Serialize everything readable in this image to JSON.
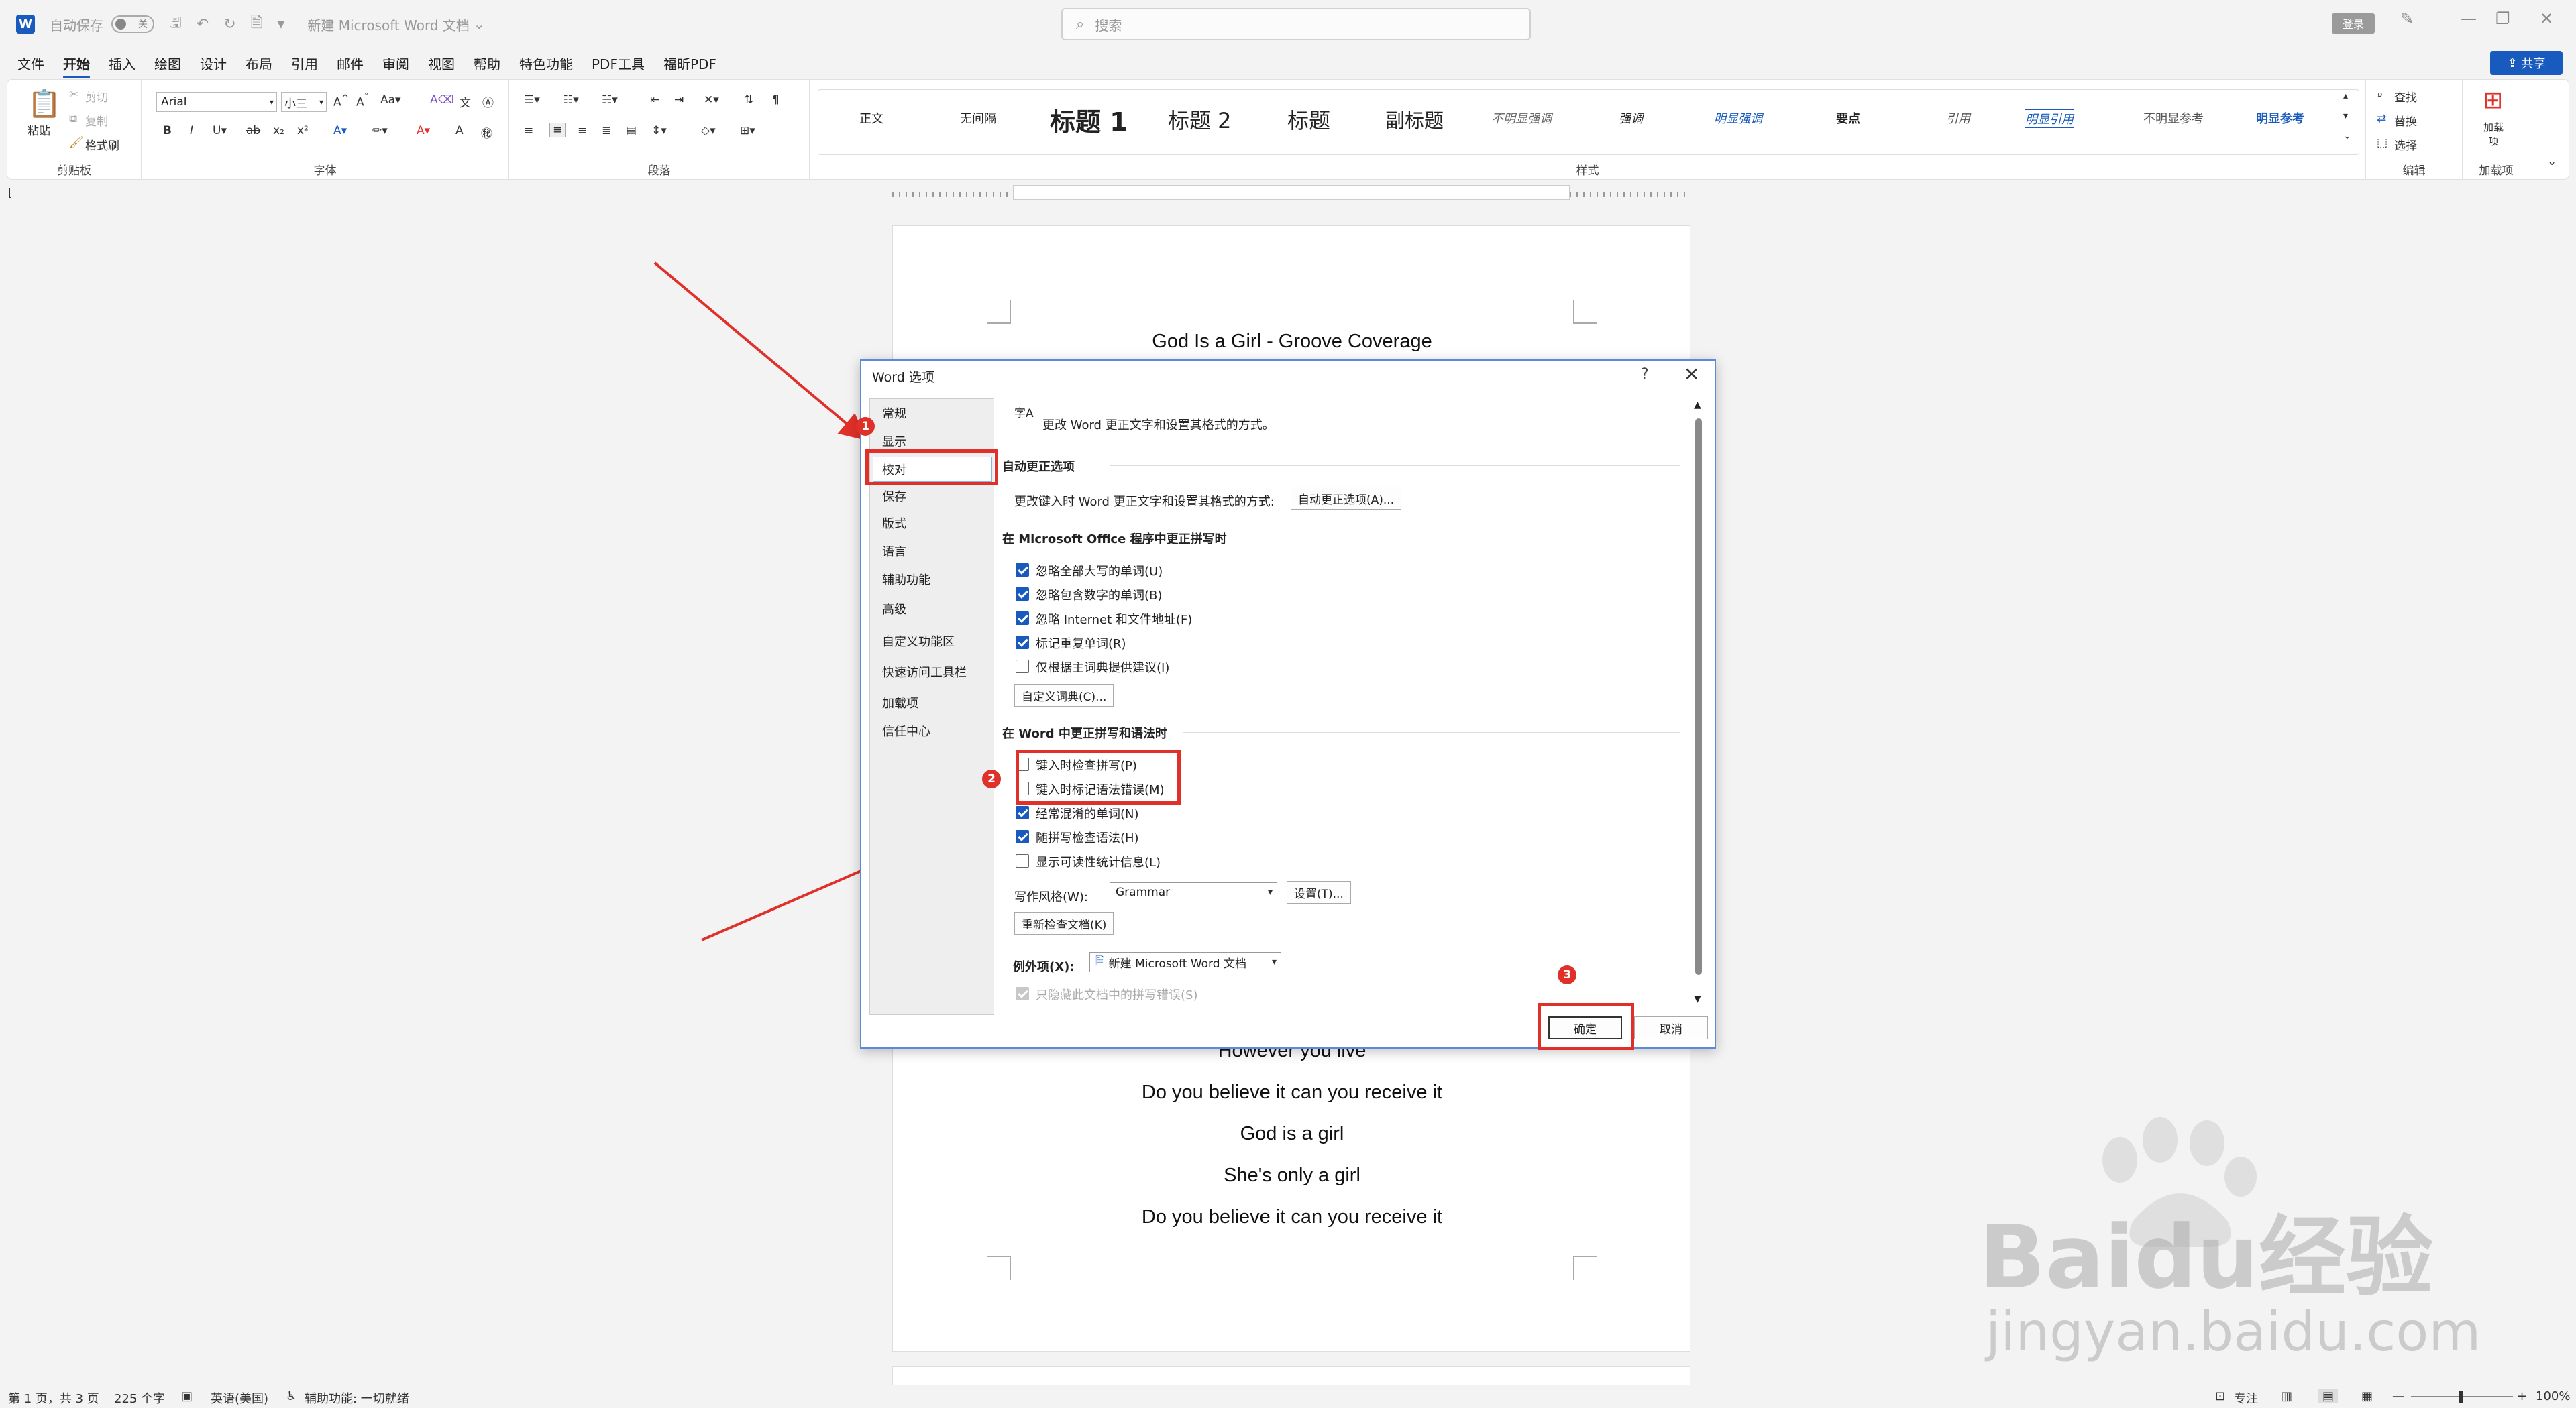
{
  "titlebar": {
    "autosave_label": "自动保存",
    "autosave_state": "关",
    "doc_title": "新建 Microsoft Word 文档",
    "search_placeholder": "搜索",
    "signin_label": "登录"
  },
  "menu": {
    "tabs": [
      "文件",
      "开始",
      "插入",
      "绘图",
      "设计",
      "布局",
      "引用",
      "邮件",
      "审阅",
      "视图",
      "帮助",
      "特色功能",
      "PDF工具",
      "福昕PDF"
    ],
    "active_index": 1,
    "share_label": "共享"
  },
  "ribbon": {
    "clipboard": {
      "paste": "粘贴",
      "cut": "剪切",
      "copy": "复制",
      "format_painter": "格式刷",
      "label": "剪贴板"
    },
    "font": {
      "name": "Arial",
      "size": "小三",
      "label": "字体"
    },
    "paragraph": {
      "label": "段落"
    },
    "styles": {
      "label": "样式",
      "items": [
        "正文",
        "无间隔",
        "标题 1",
        "标题 2",
        "标题",
        "副标题",
        "不明显强调",
        "强调",
        "明显强调",
        "要点",
        "引用",
        "明显引用",
        "不明显参考",
        "明显参考"
      ]
    },
    "editing": {
      "find": "查找",
      "replace": "替换",
      "select": "选择",
      "label": "编辑"
    },
    "addins": {
      "button": "加载项",
      "label": "加载项"
    }
  },
  "document": {
    "title_line": "God Is a Girl - Groove Coverage",
    "lines": [
      "However you live",
      "Do you believe it can you receive it",
      "God is a girl",
      "She's only a girl",
      "Do you believe it can you receive it"
    ]
  },
  "dialog": {
    "title": "Word 选项",
    "help": "?",
    "close": "✕",
    "nav": [
      "常规",
      "显示",
      "校对",
      "保存",
      "版式",
      "语言",
      "辅助功能",
      "高级",
      "自定义功能区",
      "快速访问工具栏",
      "加载项",
      "信任中心"
    ],
    "selected_nav": "校对",
    "header_icon_text": "字A",
    "header_desc": "更改 Word 更正文字和设置其格式的方式。",
    "autocorrect": {
      "heading": "自动更正选项",
      "desc": "更改键入时 Word 更正文字和设置其格式的方式:",
      "button": "自动更正选项(A)..."
    },
    "office_section": {
      "heading": "在 Microsoft Office 程序中更正拼写时",
      "options": [
        {
          "label": "忽略全部大写的单词(U)",
          "checked": true
        },
        {
          "label": "忽略包含数字的单词(B)",
          "checked": true
        },
        {
          "label": "忽略 Internet 和文件地址(F)",
          "checked": true
        },
        {
          "label": "标记重复单词(R)",
          "checked": true
        },
        {
          "label": "仅根据主词典提供建议(I)",
          "checked": false
        }
      ],
      "dict_button": "自定义词典(C)..."
    },
    "word_section": {
      "heading": "在 Word 中更正拼写和语法时",
      "options": [
        {
          "label": "键入时检查拼写(P)",
          "checked": false
        },
        {
          "label": "键入时标记语法错误(M)",
          "checked": false
        },
        {
          "label": "经常混淆的单词(N)",
          "checked": true
        },
        {
          "label": "随拼写检查语法(H)",
          "checked": true
        },
        {
          "label": "显示可读性统计信息(L)",
          "checked": false
        }
      ],
      "style_label": "写作风格(W):",
      "style_value": "Grammar",
      "settings_button": "设置(T)...",
      "recheck_button": "重新检查文档(K)"
    },
    "exceptions": {
      "label": "例外项(X):",
      "doc_value": "新建 Microsoft Word 文档",
      "hide_option": "只隐藏此文档中的拼写错误(S)"
    },
    "ok": "确定",
    "cancel": "取消"
  },
  "annotations": {
    "badges": [
      "1",
      "2",
      "3"
    ],
    "color": "#e0302a"
  },
  "statusbar": {
    "page": "第 1 页，共 3 页",
    "words": "225 个字",
    "language": "英语(美国)",
    "accessibility": "辅助功能: 一切就绪",
    "focus": "专注",
    "zoom": "100%"
  },
  "watermark": {
    "brand": "Baidu经验",
    "url": "jingyan.baidu.com"
  },
  "colors": {
    "accent": "#185abd",
    "annotation": "#e0302a"
  }
}
